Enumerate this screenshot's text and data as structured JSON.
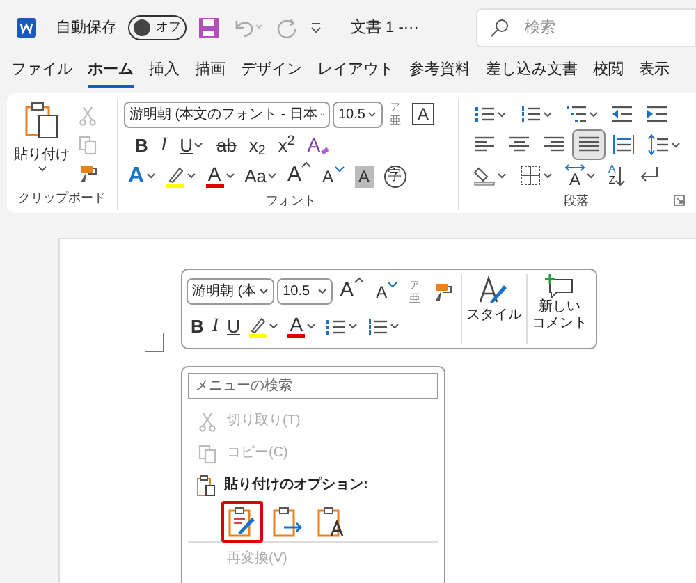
{
  "title_bar": {
    "autosave": {
      "label": "自動保存",
      "on": false,
      "state_label": "オフ"
    },
    "document_title": "文書 1 -···",
    "search": {
      "placeholder": "検索"
    }
  },
  "tabs": [
    {
      "label": "ファイル",
      "selected": false
    },
    {
      "label": "ホーム",
      "selected": true
    },
    {
      "label": "挿入",
      "selected": false
    },
    {
      "label": "描画",
      "selected": false
    },
    {
      "label": "デザイン",
      "selected": false
    },
    {
      "label": "レイアウト",
      "selected": false
    },
    {
      "label": "参考資料",
      "selected": false
    },
    {
      "label": "差し込み文書",
      "selected": false
    },
    {
      "label": "校閲",
      "selected": false
    },
    {
      "label": "表示",
      "selected": false
    }
  ],
  "ribbon": {
    "clipboard": {
      "label": "クリップボード",
      "paste": "貼り付け",
      "tools": [
        {
          "kind": "cut",
          "disabled": true
        },
        {
          "kind": "copy",
          "disabled": true
        },
        {
          "kind": "painter",
          "disabled": false
        }
      ]
    },
    "font": {
      "label": "フォント",
      "font_name": "游明朝 (本文のフォント - 日本",
      "font_size": "10.5",
      "row1": [
        {
          "kind": "ruby",
          "labels": [
            "ア",
            "亜"
          ],
          "dropdown": false
        },
        {
          "kind": "boxed",
          "label": "A",
          "dropdown": false
        }
      ],
      "row2": [
        {
          "kind": "bold",
          "label": "B",
          "dropdown": false
        },
        {
          "kind": "italic",
          "label": "I",
          "dropdown": false
        },
        {
          "kind": "underline",
          "label": "U",
          "dropdown": true
        },
        {
          "kind": "strike",
          "label": "ab",
          "dropdown": false
        },
        {
          "kind": "plain",
          "label": "x$_{2}$",
          "dropdown": false
        },
        {
          "kind": "plain",
          "label": "x$^{2}$",
          "dropdown": false
        },
        {
          "kind": "clear",
          "label": "A",
          "dropdown": false
        }
      ],
      "row3": [
        {
          "kind": "effect",
          "label": "A",
          "dropdown": true
        },
        {
          "kind": "highlight",
          "dropdown": true
        },
        {
          "kind": "fontcolor",
          "label": "A",
          "dropdown": true
        },
        {
          "kind": "plain",
          "label": "Aa",
          "dropdown": true
        },
        {
          "kind": "grow",
          "label": "A",
          "dropdown": false
        },
        {
          "kind": "shrink",
          "label": "A",
          "dropdown": false
        },
        {
          "kind": "shaded",
          "label": "A",
          "dropdown": false
        },
        {
          "kind": "circled",
          "label": "字",
          "dropdown": false
        }
      ]
    },
    "paragraph": {
      "label": "段落",
      "rows": [
        [
          {
            "kind": "bullets",
            "dropdown": true,
            "selected": false
          },
          {
            "kind": "numbering",
            "dropdown": true,
            "selected": false
          },
          {
            "kind": "multilevel",
            "dropdown": true,
            "selected": false
          },
          {
            "kind": "outdent",
            "dropdown": false,
            "selected": false
          },
          {
            "kind": "indent",
            "dropdown": false,
            "selected": false
          }
        ],
        [
          {
            "kind": "left",
            "dropdown": false,
            "selected": false
          },
          {
            "kind": "center",
            "dropdown": false,
            "selected": false
          },
          {
            "kind": "right",
            "dropdown": false,
            "selected": false
          },
          {
            "kind": "justify",
            "dropdown": false,
            "selected": true
          },
          {
            "kind": "distribute",
            "dropdown": false,
            "selected": false
          },
          {
            "kind": "spacing",
            "dropdown": true,
            "selected": false
          }
        ],
        [
          {
            "kind": "shading",
            "dropdown": true,
            "selected": false
          },
          {
            "kind": "borders",
            "dropdown": true,
            "selected": false
          },
          {
            "kind": "asian",
            "label": "A",
            "dropdown": true,
            "selected": false
          },
          {
            "kind": "sort",
            "labels": [
              "A",
              "Z"
            ],
            "dropdown": false,
            "selected": false
          },
          {
            "kind": "marks",
            "dropdown": false,
            "selected": false
          }
        ]
      ]
    }
  },
  "mini_toolbar": {
    "font_name": "游明朝 (本",
    "font_size": "10.5",
    "row1": [
      {
        "kind": "grow",
        "label": "A",
        "dropdown": false
      },
      {
        "kind": "shrink",
        "label": "A",
        "dropdown": false
      },
      {
        "kind": "ruby",
        "labels": [
          "ア",
          "亜"
        ],
        "dropdown": false
      },
      {
        "kind": "painter",
        "dropdown": false
      }
    ],
    "row2": [
      {
        "kind": "bold",
        "label": "B",
        "dropdown": false
      },
      {
        "kind": "italic",
        "label": "I",
        "dropdown": false
      },
      {
        "kind": "underline",
        "label": "U",
        "dropdown": false
      },
      {
        "kind": "highlight",
        "dropdown": true
      },
      {
        "kind": "fontcolor",
        "label": "A",
        "dropdown": true
      },
      {
        "kind": "bullets",
        "dropdown": true
      },
      {
        "kind": "numbering",
        "dropdown": true
      }
    ],
    "styles": "スタイル",
    "comment": [
      "新しい",
      "コメント"
    ]
  },
  "context_menu": {
    "search": {
      "placeholder": "メニューの検索"
    },
    "items": [
      {
        "kind": "cut",
        "label": "切り取り(T)",
        "disabled": true
      },
      {
        "kind": "copy",
        "label": "コピー(C)",
        "disabled": true
      },
      {
        "kind": "heading",
        "label": "貼り付けのオプション:"
      },
      {
        "kind": "paste_options",
        "options": [
          {
            "selected": true
          },
          {
            "selected": false
          },
          {
            "selected": false
          }
        ]
      },
      {
        "kind": "reconvert",
        "label": "再変換(V)",
        "disabled": true
      }
    ]
  }
}
